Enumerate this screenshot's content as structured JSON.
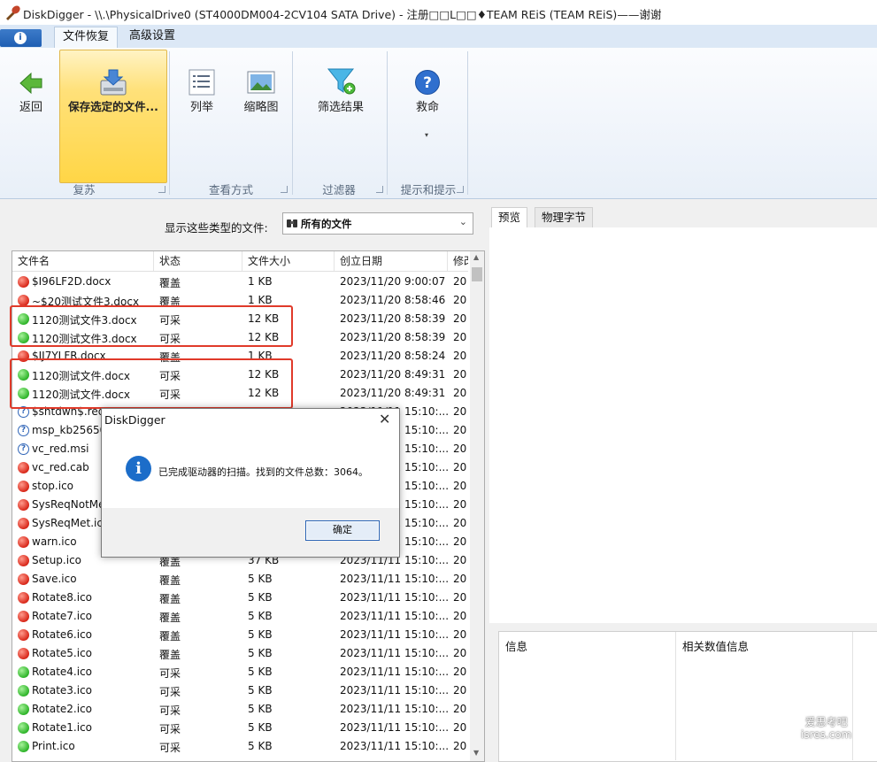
{
  "window": {
    "title": "DiskDigger - \\\\.\\PhysicalDrive0 (ST4000DM004-2CV104 SATA Drive) - 注册□□L□□♦TEAM REiS (TEAM REiS)——谢谢"
  },
  "ribbon": {
    "tabs": [
      "文件恢复",
      "高级设置"
    ],
    "buttons": {
      "back": "返回",
      "save": "保存选定的文件...",
      "list": "列举",
      "thumbs": "缩略图",
      "filter": "筛选结果",
      "help": "救命"
    },
    "groups": [
      "复苏",
      "查看方式",
      "过滤器",
      "提示和提示"
    ]
  },
  "filter": {
    "label": "显示这些类型的文件:",
    "value": "所有的文件"
  },
  "list": {
    "columns": [
      "文件名",
      "状态",
      "文件大小",
      "创立日期",
      "修改"
    ],
    "rows": [
      {
        "icon": "red",
        "name": "$I96LF2D.docx",
        "status": "覆盖",
        "size": "1 KB",
        "created": "2023/11/20 9:00:07",
        "mod": "20"
      },
      {
        "icon": "red",
        "name": "~$20测试文件3.docx",
        "status": "覆盖",
        "size": "1 KB",
        "created": "2023/11/20 8:58:46",
        "mod": "20"
      },
      {
        "icon": "green",
        "name": "1120测试文件3.docx",
        "status": "可采",
        "size": "12 KB",
        "created": "2023/11/20 8:58:39",
        "mod": "20"
      },
      {
        "icon": "green",
        "name": "1120测试文件3.docx",
        "status": "可采",
        "size": "12 KB",
        "created": "2023/11/20 8:58:39",
        "mod": "20"
      },
      {
        "icon": "red",
        "name": "$IJ7YLFR.docx",
        "status": "覆盖",
        "size": "1 KB",
        "created": "2023/11/20 8:58:24",
        "mod": "20"
      },
      {
        "icon": "green",
        "name": "1120测试文件.docx",
        "status": "可采",
        "size": "12 KB",
        "created": "2023/11/20 8:49:31",
        "mod": "20"
      },
      {
        "icon": "green",
        "name": "1120测试文件.docx",
        "status": "可采",
        "size": "12 KB",
        "created": "2023/11/20 8:49:31",
        "mod": "20"
      },
      {
        "icon": "q",
        "name": "$shtdwn$.req",
        "status": "",
        "size": "",
        "created": "2023/11/11 15:10:...",
        "mod": "20"
      },
      {
        "icon": "q",
        "name": "msp_kb256503",
        "status": "",
        "size": "",
        "created": "2023/11/11 15:10:...",
        "mod": "20"
      },
      {
        "icon": "q",
        "name": "vc_red.msi",
        "status": "",
        "size": "",
        "created": "2023/11/11 15:10:...",
        "mod": "20"
      },
      {
        "icon": "red",
        "name": "vc_red.cab",
        "status": "",
        "size": "",
        "created": "2023/11/11 15:10:...",
        "mod": "20"
      },
      {
        "icon": "red",
        "name": "stop.ico",
        "status": "",
        "size": "",
        "created": "2023/11/11 15:10:...",
        "mod": "20"
      },
      {
        "icon": "red",
        "name": "SysReqNotMet",
        "status": "",
        "size": "",
        "created": "2023/11/11 15:10:...",
        "mod": "20"
      },
      {
        "icon": "red",
        "name": "SysReqMet.ico",
        "status": "",
        "size": "",
        "created": "2023/11/11 15:10:...",
        "mod": "20"
      },
      {
        "icon": "red",
        "name": "warn.ico",
        "status": "",
        "size": "",
        "created": "2023/11/11 15:10:...",
        "mod": "20"
      },
      {
        "icon": "red",
        "name": "Setup.ico",
        "status": "覆盖",
        "size": "37 KB",
        "created": "2023/11/11 15:10:...",
        "mod": "20"
      },
      {
        "icon": "red",
        "name": "Save.ico",
        "status": "覆盖",
        "size": "5 KB",
        "created": "2023/11/11 15:10:...",
        "mod": "20"
      },
      {
        "icon": "red",
        "name": "Rotate8.ico",
        "status": "覆盖",
        "size": "5 KB",
        "created": "2023/11/11 15:10:...",
        "mod": "20"
      },
      {
        "icon": "red",
        "name": "Rotate7.ico",
        "status": "覆盖",
        "size": "5 KB",
        "created": "2023/11/11 15:10:...",
        "mod": "20"
      },
      {
        "icon": "red",
        "name": "Rotate6.ico",
        "status": "覆盖",
        "size": "5 KB",
        "created": "2023/11/11 15:10:...",
        "mod": "20"
      },
      {
        "icon": "red",
        "name": "Rotate5.ico",
        "status": "覆盖",
        "size": "5 KB",
        "created": "2023/11/11 15:10:...",
        "mod": "20"
      },
      {
        "icon": "green",
        "name": "Rotate4.ico",
        "status": "可采",
        "size": "5 KB",
        "created": "2023/11/11 15:10:...",
        "mod": "20"
      },
      {
        "icon": "green",
        "name": "Rotate3.ico",
        "status": "可采",
        "size": "5 KB",
        "created": "2023/11/11 15:10:...",
        "mod": "20"
      },
      {
        "icon": "green",
        "name": "Rotate2.ico",
        "status": "可采",
        "size": "5 KB",
        "created": "2023/11/11 15:10:...",
        "mod": "20"
      },
      {
        "icon": "green",
        "name": "Rotate1.ico",
        "status": "可采",
        "size": "5 KB",
        "created": "2023/11/11 15:10:...",
        "mod": "20"
      },
      {
        "icon": "green",
        "name": "Print.ico",
        "status": "可采",
        "size": "5 KB",
        "created": "2023/11/11 15:10:...",
        "mod": "20"
      }
    ]
  },
  "preview": {
    "tabs": [
      "预览",
      "物理字节"
    ],
    "info_columns": [
      "信息",
      "相关数值信息"
    ]
  },
  "dialog": {
    "title": "DiskDigger",
    "message": "已完成驱动器的扫描。找到的文件总数：3064。",
    "ok": "确定",
    "close": "✕"
  },
  "watermark": {
    "line1": "爱思考吧",
    "line2": "isres.com"
  },
  "colors": {
    "highlight": "#e03a2a",
    "save_button": "#ffd646",
    "accent": "#1c6dc9"
  }
}
